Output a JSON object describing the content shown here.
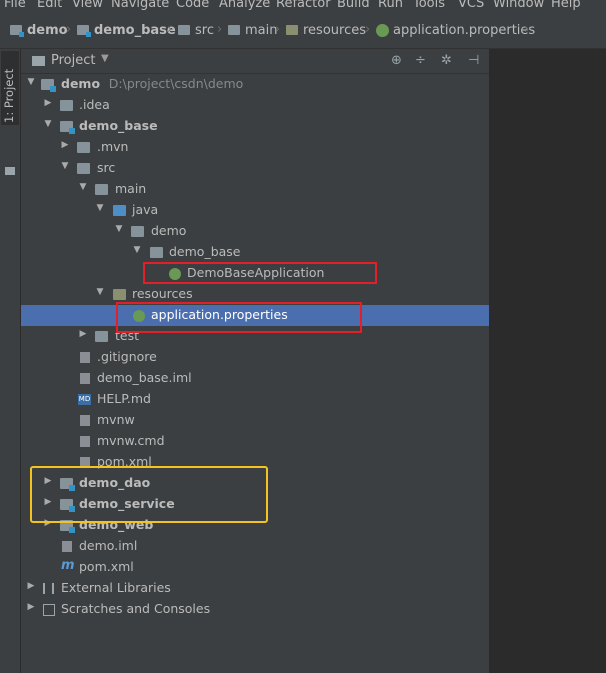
{
  "menu": [
    "File",
    "Edit",
    "View",
    "Navigate",
    "Code",
    "Analyze",
    "Refactor",
    "Build",
    "Run",
    "Tools",
    "VCS",
    "Window",
    "Help"
  ],
  "breadcrumb": [
    "demo",
    "demo_base",
    "src",
    "main",
    "resources",
    "application.properties"
  ],
  "tool_window": {
    "tab_label": "1: Project",
    "title": "Project"
  },
  "panel_tools": [
    "target-icon",
    "collapse-icon",
    "gear-icon",
    "hide-icon"
  ],
  "tree": [
    {
      "label": "demo",
      "path": "D:\\project\\csdn\\demo",
      "expanded": true,
      "icon": "module-folder-icon"
    },
    {
      "label": ".idea",
      "expanded": false,
      "icon": "folder-icon"
    },
    {
      "label": "demo_base",
      "expanded": true,
      "icon": "module-folder-icon"
    },
    {
      "label": ".mvn",
      "expanded": false,
      "icon": "folder-icon"
    },
    {
      "label": "src",
      "expanded": true,
      "icon": "folder-icon"
    },
    {
      "label": "main",
      "expanded": true,
      "icon": "folder-icon"
    },
    {
      "label": "java",
      "expanded": true,
      "icon": "source-folder-icon"
    },
    {
      "label": "demo",
      "expanded": true,
      "icon": "package-icon"
    },
    {
      "label": "demo_base",
      "expanded": true,
      "icon": "package-icon"
    },
    {
      "label": "DemoBaseApplication",
      "icon": "spring-boot-class-icon"
    },
    {
      "label": "resources",
      "expanded": true,
      "icon": "resources-folder-icon"
    },
    {
      "label": "application.properties",
      "icon": "spring-properties-icon",
      "selected": true
    },
    {
      "label": "test",
      "expanded": false,
      "icon": "folder-icon"
    },
    {
      "label": ".gitignore",
      "icon": "file-icon"
    },
    {
      "label": "demo_base.iml",
      "icon": "file-icon"
    },
    {
      "label": "HELP.md",
      "icon": "markdown-icon"
    },
    {
      "label": "mvnw",
      "icon": "file-icon"
    },
    {
      "label": "mvnw.cmd",
      "icon": "file-icon"
    },
    {
      "label": "pom.xml",
      "icon": "maven-icon"
    },
    {
      "label": "demo_dao",
      "expanded": false,
      "icon": "module-folder-icon"
    },
    {
      "label": "demo_service",
      "expanded": false,
      "icon": "module-folder-icon"
    },
    {
      "label": "demo_web",
      "expanded": false,
      "icon": "module-folder-icon"
    },
    {
      "label": "demo.iml",
      "icon": "file-icon"
    },
    {
      "label": "pom.xml",
      "icon": "maven-icon"
    },
    {
      "label": "External Libraries",
      "expanded": false,
      "icon": "library-icon"
    },
    {
      "label": "Scratches and Consoles",
      "expanded": false,
      "icon": "scratches-icon"
    }
  ],
  "colors": {
    "selection": "#4b6eaf",
    "red_box": "#e3202a",
    "yellow_box": "#f4c31f",
    "panel_bg": "#3c3f41"
  }
}
